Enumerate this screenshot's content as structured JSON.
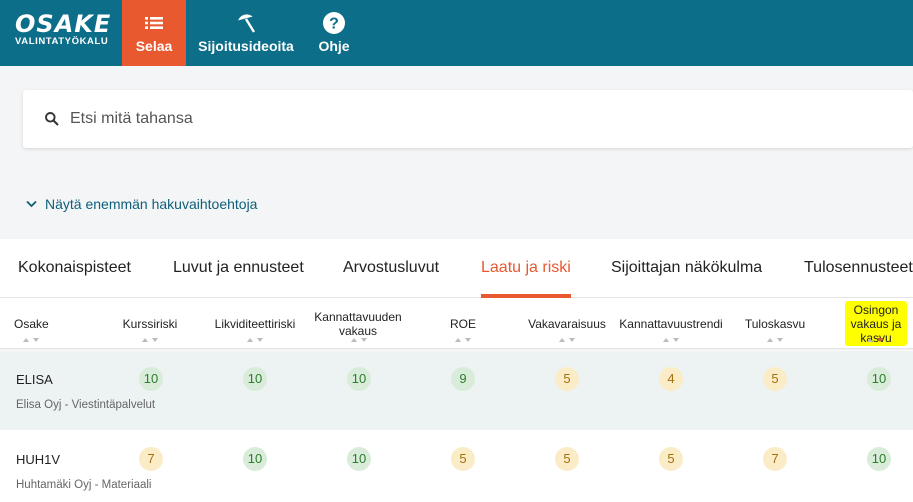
{
  "logo": {
    "main": "OSAKE",
    "sub": "VALINTATYÖKALU"
  },
  "nav": [
    {
      "label": "Selaa",
      "icon": "list-icon"
    },
    {
      "label": "Sijoitusideoita",
      "icon": "beach-umbrella-icon"
    },
    {
      "label": "Ohje",
      "icon": "help-icon"
    }
  ],
  "search": {
    "placeholder": "Etsi mitä tahansa"
  },
  "more_options": {
    "label": "Näytä enemmän hakuvaihtoehtoja"
  },
  "tabs": [
    "Kokonaispisteet",
    "Luvut ja ennusteet",
    "Arvostusluvut",
    "Laatu ja riski",
    "Sijoittajan näkökulma",
    "Tulosennusteet"
  ],
  "active_tab": "Laatu ja riski",
  "columns": {
    "osake": "Osake",
    "kurssiriski": "Kurssiriski",
    "likviditeettiriski": "Likviditeettiriski",
    "kannattavuuden_vakaus_1": "Kannattavuuden",
    "kannattavuuden_vakaus_2": "vakaus",
    "roe": "ROE",
    "vakavaraisuus": "Vakavaraisuus",
    "kannattavuustrendi": "Kannattavuustrendi",
    "tuloskasvu": "Tuloskasvu",
    "osingon_1": "Osingon",
    "osingon_2": "vakaus ja",
    "osingon_3": "kasvu"
  },
  "rows": [
    {
      "ticker": "ELISA",
      "company": "Elisa Oyj - Viestintäpalvelut",
      "scores": [
        "10",
        "10",
        "10",
        "9",
        "5",
        "4",
        "5",
        "10"
      ]
    },
    {
      "ticker": "HUH1V",
      "company": "Huhtamäki Oyj - Materiaali",
      "scores": [
        "7",
        "10",
        "10",
        "5",
        "5",
        "5",
        "7",
        "10"
      ]
    }
  ],
  "colors": {
    "nav": "#0d6e8a",
    "accent": "#e85930",
    "score_green": "#d9ecd9",
    "score_amber": "#fbecc8"
  }
}
